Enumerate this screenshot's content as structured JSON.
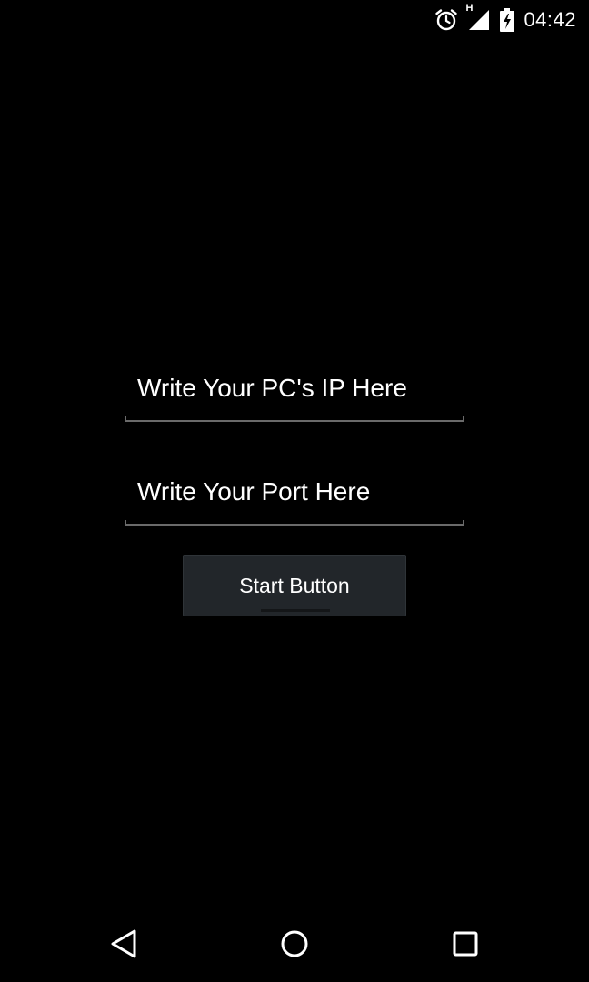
{
  "status_bar": {
    "time": "04:42",
    "network_type": "H",
    "icons": [
      "alarm-icon",
      "signal-icon",
      "battery-charging-icon"
    ]
  },
  "form": {
    "ip_field": {
      "placeholder": "Write Your PC's IP Here",
      "value": ""
    },
    "port_field": {
      "placeholder": "Write Your Port Here",
      "value": ""
    },
    "start_button": {
      "label": "Start Button"
    }
  },
  "nav_bar": {
    "buttons": [
      "back-icon",
      "home-icon",
      "recents-icon"
    ]
  },
  "colors": {
    "background": "#000000",
    "text": "#ffffff",
    "button_background": "#22262a",
    "underline": "#6a6a6a"
  }
}
